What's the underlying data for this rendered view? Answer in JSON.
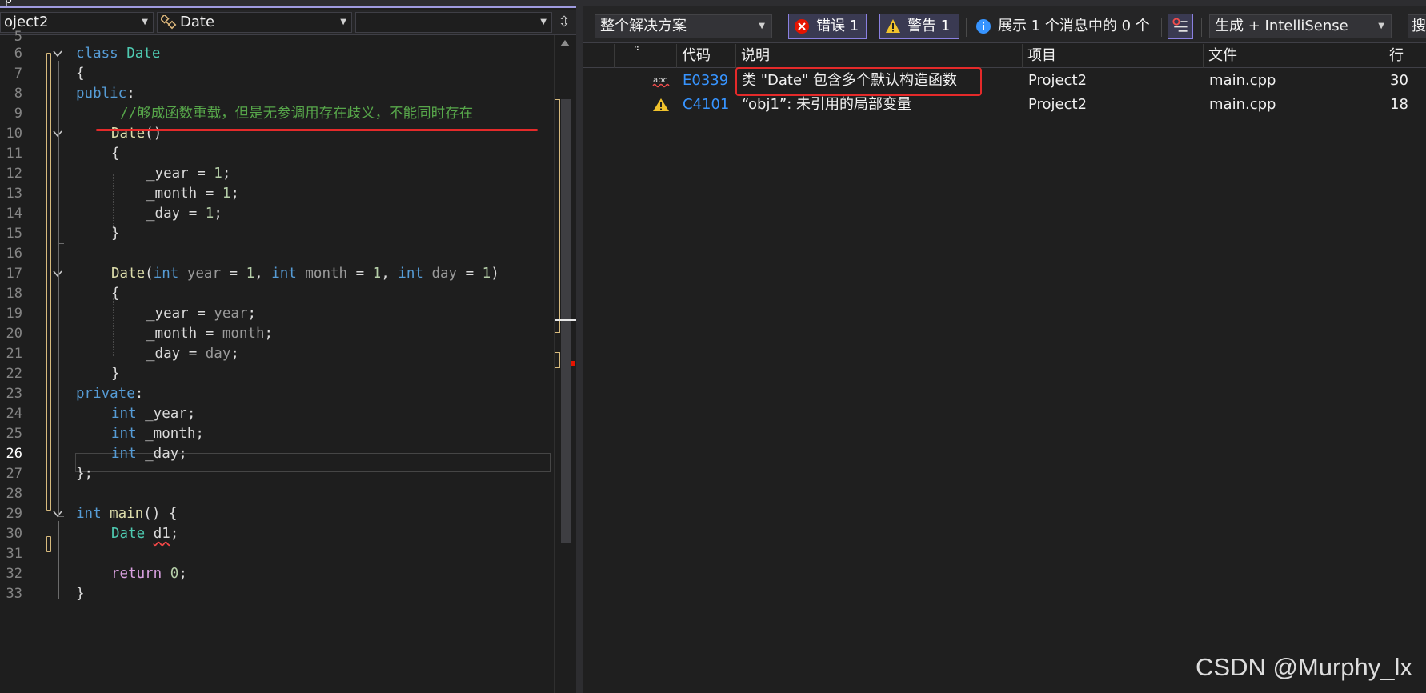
{
  "editor": {
    "tab_fragment": "p",
    "nav": {
      "project": "oject2",
      "scope": "Date",
      "member": ""
    },
    "line_numbers": [
      "5",
      "6",
      "7",
      "8",
      "9",
      "10",
      "11",
      "12",
      "13",
      "14",
      "15",
      "16",
      "17",
      "18",
      "19",
      "20",
      "21",
      "22",
      "23",
      "24",
      "25",
      "26",
      "27",
      "28",
      "29",
      "30",
      "31",
      "32",
      "33"
    ],
    "current_line": "26",
    "code": {
      "l6_kw": "class",
      "l6_name": "Date",
      "l7": "{",
      "l8_kw": "public",
      "l8_colon": ":",
      "l9_comment": "//够成函数重载，但是无参调用存在歧义，不能同时存在",
      "l10_fn": "Date",
      "l10_parens": "()",
      "l11": "{",
      "l12_member": "_year",
      "l12_eq": " = ",
      "l12_num": "1",
      "l12_semi": ";",
      "l13_member": "_month",
      "l13_eq": " = ",
      "l13_num": "1",
      "l13_semi": ";",
      "l14_member": "_day",
      "l14_eq": " = ",
      "l14_num": "1",
      "l14_semi": ";",
      "l15": "}",
      "l17_fn": "Date",
      "l17_open": "(",
      "l17_kw1": "int",
      "l17_p1": " year",
      "l17_eq1": " = ",
      "l17_n1": "1",
      "l17_c1": ", ",
      "l17_kw2": "int",
      "l17_p2": " month",
      "l17_eq2": " = ",
      "l17_n2": "1",
      "l17_c2": ", ",
      "l17_kw3": "int",
      "l17_p3": " day",
      "l17_eq3": " = ",
      "l17_n3": "1",
      "l17_close": ")",
      "l18": "{",
      "l19_member": "_year",
      "l19_eq": " = ",
      "l19_param": "year",
      "l19_semi": ";",
      "l20_member": "_month",
      "l20_eq": " = ",
      "l20_param": "month",
      "l20_semi": ";",
      "l21_member": "_day",
      "l21_eq": " = ",
      "l21_param": "day",
      "l21_semi": ";",
      "l22": "}",
      "l23_kw": "private",
      "l23_colon": ":",
      "l24_kw": "int",
      "l24_member": " _year",
      "l24_semi": ";",
      "l25_kw": "int",
      "l25_member": " _month",
      "l25_semi": ";",
      "l26_kw": "int",
      "l26_member": " _day",
      "l26_semi": ";",
      "l27": "};",
      "l29_kw": "int",
      "l29_fn": " main",
      "l29_rest": "() {",
      "l30_type": "Date",
      "l30_sp": " ",
      "l30_var": "d1",
      "l30_semi": ";",
      "l32_kw": "return",
      "l32_sp": " ",
      "l32_num": "0",
      "l32_semi": ";",
      "l33": "}"
    }
  },
  "error_list": {
    "toolbar": {
      "scope": "整个解决方案",
      "errors_label": "错误 1",
      "warnings_label": "警告 1",
      "messages_label": "展示 1 个消息中的 0 个",
      "build_filter": "生成 + IntelliSense",
      "search_fragment": "搜索"
    },
    "columns": {
      "code": "代码",
      "description": "说明",
      "project": "项目",
      "file": "文件",
      "line": "行"
    },
    "rows": [
      {
        "icon": "spell-error-icon",
        "code": "E0339",
        "description": "类 \"Date\" 包含多个默认构造函数",
        "project": "Project2",
        "file": "main.cpp",
        "line": "30"
      },
      {
        "icon": "warning-icon",
        "code": "C4101",
        "description": "“obj1”: 未引用的局部变量",
        "project": "Project2",
        "file": "main.cpp",
        "line": "18"
      }
    ]
  },
  "watermark": "CSDN @Murphy_lx",
  "colors": {
    "keyword": "#569cd6",
    "type": "#4ec9b0",
    "function": "#dcdcaa",
    "number": "#b5cea8",
    "comment": "#57a64a",
    "control": "#d8a0df",
    "error_red": "#e52a2a",
    "toggle_border": "#8a80e0",
    "link_blue": "#3794ff"
  }
}
